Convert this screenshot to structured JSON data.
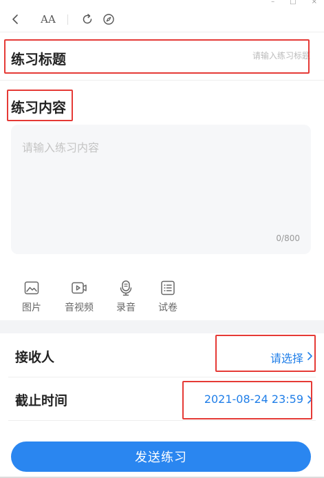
{
  "window_controls": {
    "minimize": "–",
    "maximize": "□",
    "close": "×"
  },
  "toolbar": {
    "back_icon": "chevron-left-icon",
    "font_size_icon": "font-size-icon",
    "font_size_glyph": "AA",
    "refresh_icon": "refresh-icon",
    "compass_icon": "compass-icon"
  },
  "title_field": {
    "label": "练习标题",
    "placeholder": "请输入练习标题",
    "value": ""
  },
  "content_field": {
    "label": "练习内容",
    "placeholder": "请输入练习内容",
    "value": "",
    "char_count": "0/800"
  },
  "attachments": [
    {
      "label": "图片",
      "icon": "image-icon"
    },
    {
      "label": "音视频",
      "icon": "video-icon"
    },
    {
      "label": "录音",
      "icon": "microphone-icon"
    },
    {
      "label": "试卷",
      "icon": "exam-paper-icon"
    }
  ],
  "receiver": {
    "label": "接收人",
    "value": "请选择"
  },
  "deadline": {
    "label": "截止时间",
    "value": "2021-08-24 23:59"
  },
  "submit": {
    "label": "发送练习"
  },
  "colors": {
    "accent": "#2a86f0",
    "link": "#1f7ee8",
    "highlight_box": "#e53935",
    "input_bg": "#f6f7f9"
  }
}
